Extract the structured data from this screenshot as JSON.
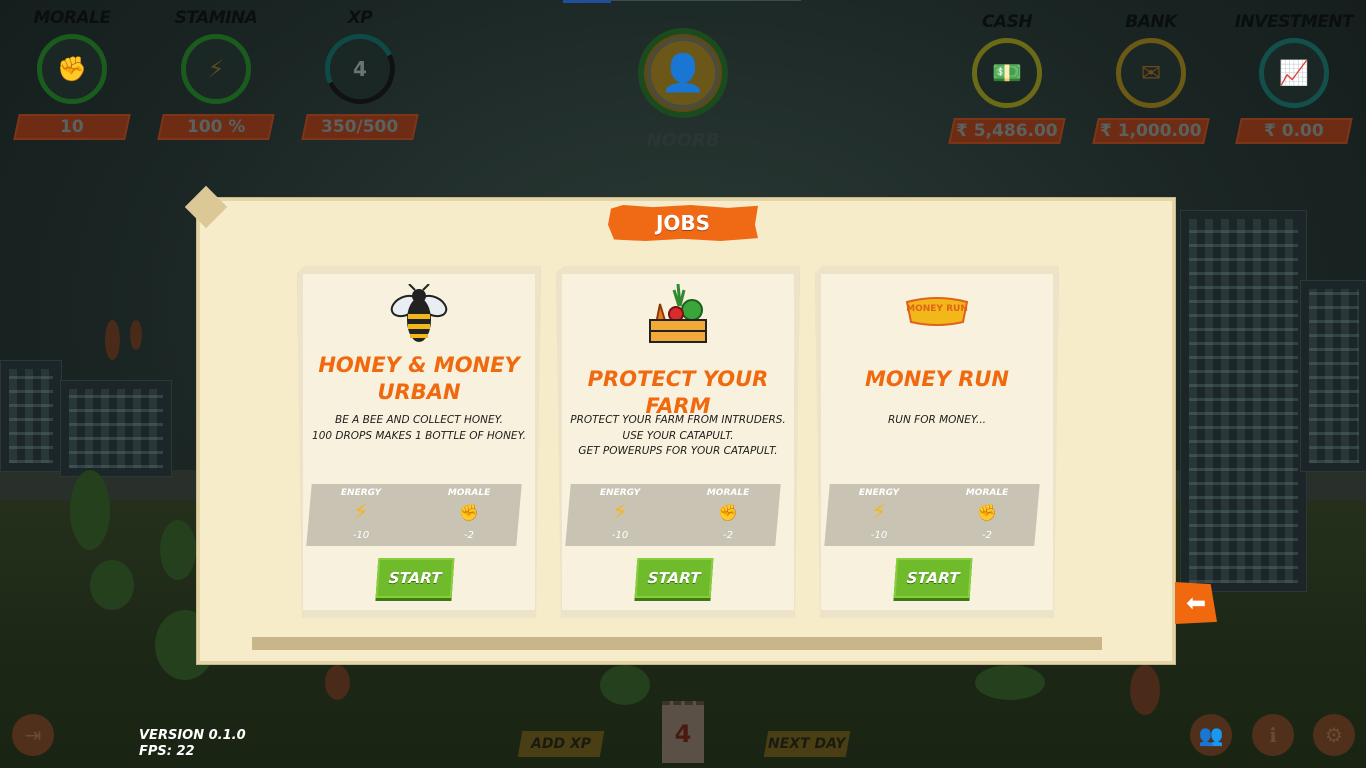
{
  "hud": {
    "stats": [
      {
        "title": "MORALE",
        "value": "10",
        "icon": "morale-fist-icon"
      },
      {
        "title": "STAMINA",
        "value": "100 %",
        "icon": "lightning-icon"
      },
      {
        "title": "XP",
        "value": "350/500",
        "level": "4",
        "progress": 0.7
      }
    ],
    "player": {
      "name": "NOORB",
      "icon": "user-avatar-icon"
    },
    "finance": [
      {
        "title": "CASH",
        "value": "₹ 5,486.00",
        "icon": "cash-stack-icon"
      },
      {
        "title": "BANK",
        "value": "₹ 1,000.00",
        "icon": "bank-envelope-icon"
      },
      {
        "title": "INVESTMENT",
        "value": "₹ 0.00",
        "icon": "investment-chart-icon"
      }
    ]
  },
  "jobs_panel": {
    "title": "JOBS",
    "jobs": [
      {
        "title": "HONEY & MONEY URBAN",
        "description_lines": [
          "BE A BEE AND COLLECT HONEY.",
          "100 DROPS MAKES 1 BOTTLE OF HONEY."
        ],
        "energy_label": "ENERGY",
        "energy_value": "-10",
        "morale_label": "MORALE",
        "morale_value": "-2",
        "start_label": "START",
        "icon": "bee-icon"
      },
      {
        "title": "PROTECT YOUR FARM",
        "description_lines": [
          "PROTECT YOUR FARM FROM INTRUDERS.",
          "USE YOUR CATAPULT.",
          "GET POWERUPS FOR YOUR CATAPULT."
        ],
        "energy_label": "ENERGY",
        "energy_value": "-10",
        "morale_label": "MORALE",
        "morale_value": "-2",
        "start_label": "START",
        "icon": "vegetable-crate-icon"
      },
      {
        "title": "MONEY RUN",
        "logo_text": "MONEY RUN",
        "description_lines": [
          "RUN FOR MONEY..."
        ],
        "energy_label": "ENERGY",
        "energy_value": "-10",
        "morale_label": "MORALE",
        "morale_value": "-2",
        "start_label": "START",
        "icon": "money-run-logo"
      }
    ]
  },
  "bottom": {
    "version": "VERSION 0.1.0",
    "fps": "FPS: 22",
    "add_xp": "ADD XP",
    "day": "4",
    "next_day": "NEXT DAY"
  },
  "colors": {
    "accent": "#f0690f",
    "start_green": "#6fbb2b",
    "panel": "#f6ecca"
  }
}
